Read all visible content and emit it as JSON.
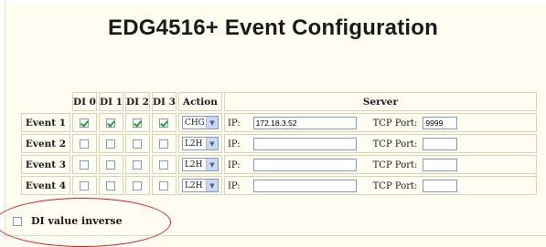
{
  "title": "EDG4516+ Event Configuration",
  "columns": {
    "di0": "DI 0",
    "di1": "DI 1",
    "di2": "DI 2",
    "di3": "DI 3",
    "action": "Action",
    "server": "Server"
  },
  "labels": {
    "ip": "IP:",
    "tcp_port": "TCP Port:"
  },
  "events": [
    {
      "label": "Event 1",
      "di": [
        true,
        true,
        true,
        true
      ],
      "action": "CHG",
      "ip": "172.18.3.52",
      "port": "9999"
    },
    {
      "label": "Event 2",
      "di": [
        false,
        false,
        false,
        false
      ],
      "action": "L2H",
      "ip": "",
      "port": ""
    },
    {
      "label": "Event 3",
      "di": [
        false,
        false,
        false,
        false
      ],
      "action": "L2H",
      "ip": "",
      "port": ""
    },
    {
      "label": "Event 4",
      "di": [
        false,
        false,
        false,
        false
      ],
      "action": "L2H",
      "ip": "",
      "port": ""
    }
  ],
  "di_inverse": {
    "label": "DI value inverse",
    "checked": false
  },
  "highlight_color": "#d42020",
  "checkmark_color": "#21a121"
}
